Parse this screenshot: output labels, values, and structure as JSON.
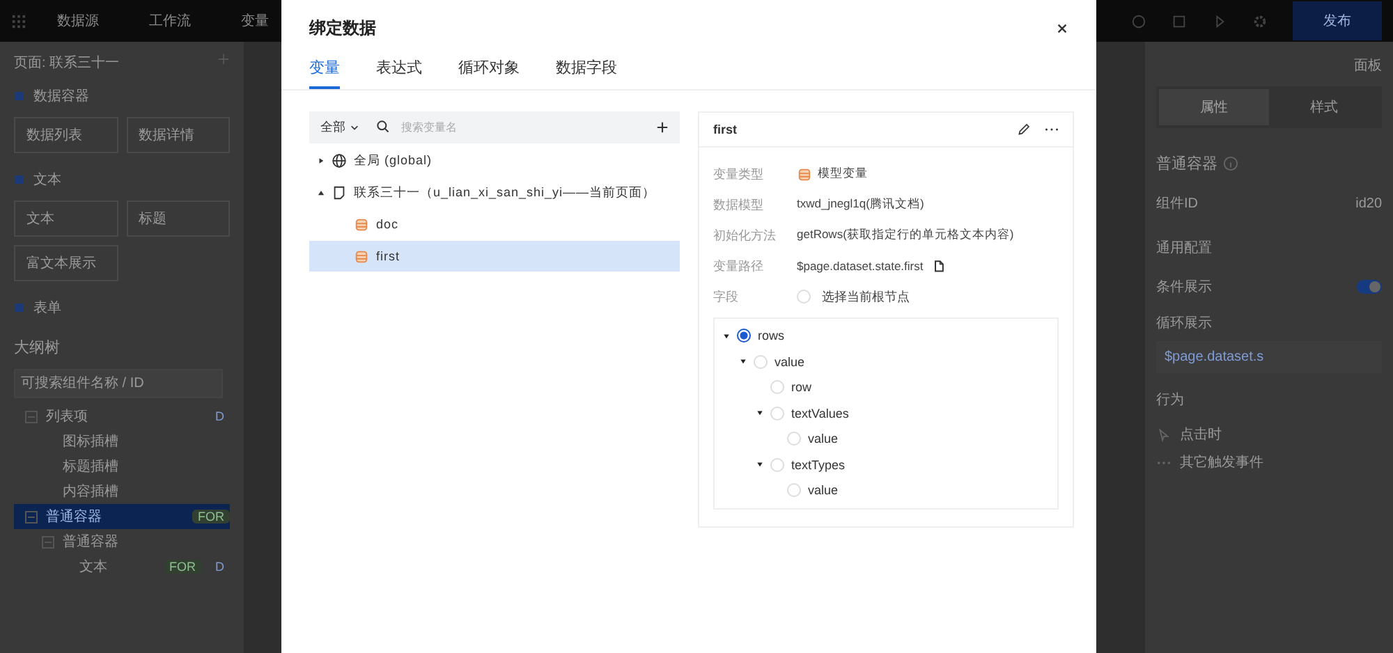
{
  "topbar": {
    "items": [
      {
        "label": "数据源"
      },
      {
        "label": "工作流"
      },
      {
        "label": "变量"
      }
    ],
    "publish": "发布"
  },
  "left_panel": {
    "page": "页面: 联系三十一",
    "groups": [
      {
        "title": "数据容器",
        "items": [
          "数据列表",
          "数据详情"
        ]
      },
      {
        "title": "文本",
        "items": [
          "文本",
          "标题",
          "富文本展示"
        ]
      },
      {
        "title": "表单"
      }
    ]
  },
  "outline": {
    "title": "大纲树",
    "search_placeholder": "可搜索组件名称 / ID",
    "nodes": [
      {
        "label": "列表项",
        "badges": [
          "D"
        ],
        "selected": false,
        "expanded": true,
        "children": [
          {
            "label": "图标插槽",
            "selected": false
          },
          {
            "label": "标题插槽",
            "selected": false
          },
          {
            "label": "内容插槽",
            "selected": false
          }
        ]
      },
      {
        "label": "普通容器",
        "badges": [
          "FOR"
        ],
        "selected": true,
        "expanded": true,
        "children": [
          {
            "label": "普通容器",
            "selected": false,
            "expanded": true,
            "children": [
              {
                "label": "文本",
                "badges": [
                  "FOR",
                  "D"
                ],
                "selected": false
              }
            ]
          }
        ]
      }
    ]
  },
  "right_panel": {
    "header": "面板",
    "tabs": [
      {
        "label": "属性",
        "selected": true
      },
      {
        "label": "样式",
        "selected": false
      }
    ],
    "component": "普通容器",
    "id_label": "组件ID",
    "id_value": "id20",
    "general": "通用配置",
    "conditional": {
      "label": "条件展示",
      "on": true
    },
    "loop": {
      "label": "循环展示",
      "binding": "$page.dataset.s"
    },
    "behavior": "行为",
    "events": [
      {
        "label": "点击时",
        "kind": "click"
      },
      {
        "label": "其它触发事件",
        "kind": "more"
      }
    ]
  },
  "dialog": {
    "title": "绑定数据",
    "tabs": [
      {
        "label": "变量",
        "selected": true
      },
      {
        "label": "表达式",
        "selected": false
      },
      {
        "label": "循环对象",
        "selected": false
      },
      {
        "label": "数据字段",
        "selected": false
      }
    ],
    "filter": {
      "scope": "全部",
      "placeholder": "搜索变量名"
    },
    "var_tree": [
      {
        "label": "全局 (global)",
        "kind": "global",
        "selected": false,
        "expanded": false
      },
      {
        "label": "联系三十一（u_lian_xi_san_shi_yi——当前页面）",
        "kind": "page",
        "selected": false,
        "expanded": true,
        "children": [
          {
            "label": "doc",
            "kind": "model",
            "selected": false
          },
          {
            "label": "first",
            "kind": "model",
            "selected": true
          }
        ]
      }
    ],
    "detail": {
      "title": "first",
      "fields": [
        {
          "label": "变量类型",
          "value": "模型变量",
          "kind": "type"
        },
        {
          "label": "数据模型",
          "value": "txwd_jnegl1q(腾讯文档)",
          "kind": "text"
        },
        {
          "label": "初始化方法",
          "value": "getRows(获取指定行的单元格文本内容)",
          "kind": "text"
        },
        {
          "label": "变量路径",
          "value": "$page.dataset.state.first",
          "kind": "path"
        }
      ],
      "field_label": "字段",
      "root_option": {
        "label": "选择当前根节点",
        "selected": false
      },
      "field_tree": [
        {
          "label": "rows",
          "selected": true,
          "expanded": true,
          "children": [
            {
              "label": "value",
              "selected": false,
              "expanded": true,
              "children": [
                {
                  "label": "row",
                  "selected": false
                },
                {
                  "label": "textValues",
                  "selected": false,
                  "expanded": true,
                  "children": [
                    {
                      "label": "value",
                      "selected": false
                    }
                  ]
                },
                {
                  "label": "textTypes",
                  "selected": false,
                  "expanded": true,
                  "children": [
                    {
                      "label": "value",
                      "selected": false
                    }
                  ]
                }
              ]
            }
          ]
        }
      ]
    }
  }
}
